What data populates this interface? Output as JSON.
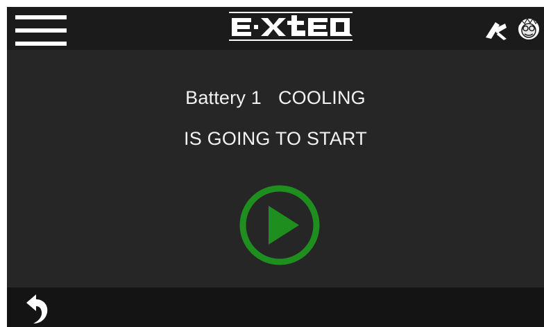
{
  "header": {
    "menu_icon": "hamburger-menu-icon",
    "logo_text": "E-XTEQ",
    "right_icons": [
      "technician-tool-icon",
      "scientist-avatar-icon"
    ]
  },
  "status": {
    "battery_label": "Battery 1",
    "mode_label": "COOLING",
    "message": "IS GOING TO START"
  },
  "actions": {
    "start_icon": "play-icon",
    "back_icon": "back-arrow-icon"
  },
  "colors": {
    "screen_bg": "#262626",
    "topbar_bg": "#1b1b1b",
    "bottombar_bg": "#141414",
    "accent_green": "#1e8f1e",
    "text": "#f2f2f2"
  }
}
